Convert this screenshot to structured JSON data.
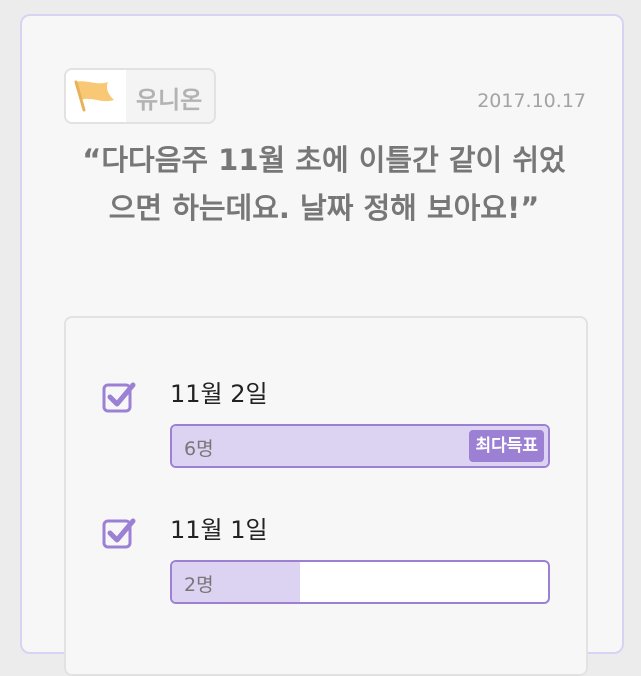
{
  "post": {
    "team_name": "유니온",
    "date": "2017.10.17",
    "question": "“다다음주 11월 초에 이틀간 같이 쉬었으면 하는데요. 날짜 정해 보아요!”"
  },
  "poll": {
    "options": [
      {
        "label": "11월 2일",
        "count_text": "6명",
        "fraction": 1.0,
        "checked": true,
        "badge": "최다득표"
      },
      {
        "label": "11월 1일",
        "count_text": "2명",
        "fraction": 0.34,
        "checked": true
      }
    ]
  },
  "colors": {
    "accent": "#9b80d4",
    "bar_fill": "#dcd2f2",
    "flag": "#f8c874"
  }
}
